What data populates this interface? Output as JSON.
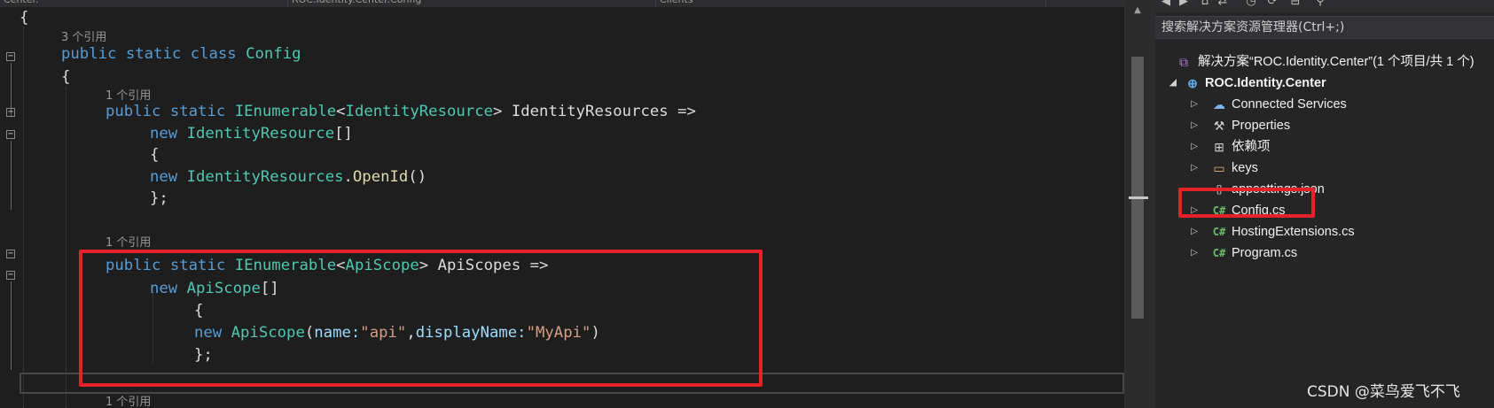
{
  "tabs": [
    "Center.",
    "ROC.Identity.Center.Config",
    "Clients"
  ],
  "code": {
    "open_brace": "{",
    "ref_3": "3 个引用",
    "ref_1": "1 个引用",
    "class_line": {
      "kw1": "public",
      "kw2": "static",
      "kw3": "class",
      "name": "Config"
    },
    "inner_brace": "{",
    "identity": {
      "kw1": "public",
      "kw2": "static",
      "type": "IEnumerable",
      "lt": "<",
      "type_arg": "IdentityResource",
      "gt": ">",
      "name": " IdentityResources ",
      "arrow": "=>",
      "new_kw": "new",
      "new_type": "IdentityResource",
      "brackets": "[]",
      "open": "{",
      "item_new": "new",
      "item_type": "IdentityResources",
      "dot": ".",
      "item_member": "OpenId",
      "parens": "()",
      "close": "};"
    },
    "apiscope": {
      "kw1": "public",
      "kw2": "static",
      "type": "IEnumerable",
      "lt": "<",
      "type_arg": "ApiScope",
      "gt": ">",
      "name": " ApiScopes ",
      "arrow": "=>",
      "new_kw": "new",
      "new_type": "ApiScope",
      "brackets": "[]",
      "open": "{",
      "item_new": "new",
      "item_type": "ApiScope",
      "paren_open": "(",
      "param1": "name:",
      "val1": "\"api\"",
      "comma": ",",
      "param2": "displayName:",
      "val2": "\"MyApi\"",
      "paren_close": ")",
      "close": "};"
    }
  },
  "solution_explorer": {
    "search_placeholder": "搜索解决方案资源管理器(Ctrl+;)",
    "solution_label": "解决方案“ROC.Identity.Center”(1 个项目/共 1 个)",
    "project_label": "ROC.Identity.Center",
    "items": [
      {
        "label": "Connected Services",
        "icon": "connected-services-icon",
        "expandable": true
      },
      {
        "label": "Properties",
        "icon": "wrench-icon",
        "expandable": true
      },
      {
        "label": "依赖项",
        "icon": "dependencies-icon",
        "expandable": true
      },
      {
        "label": "keys",
        "icon": "folder-icon",
        "expandable": true
      },
      {
        "label": "appsettings.json",
        "icon": "json-file-icon",
        "expandable": false
      },
      {
        "label": "Config.cs",
        "icon": "csharp-file-icon",
        "expandable": true
      },
      {
        "label": "HostingExtensions.cs",
        "icon": "csharp-file-icon",
        "expandable": true
      },
      {
        "label": "Program.cs",
        "icon": "csharp-file-icon",
        "expandable": true
      }
    ],
    "cs_glyph": "C#"
  },
  "watermark": "CSDN @菜鸟爱飞不飞",
  "colors": {
    "highlight_box": "#e8202a",
    "keyword": "#569cd6",
    "type": "#4ec9b0",
    "string": "#d69d85"
  }
}
